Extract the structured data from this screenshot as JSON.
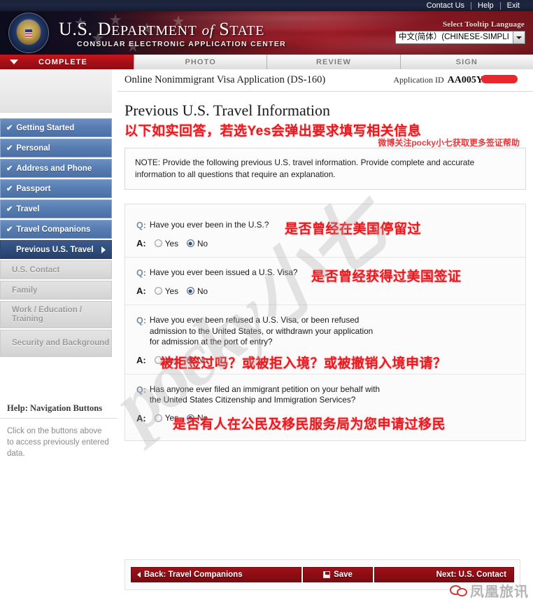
{
  "utility": {
    "links": [
      "Contact Us",
      "Help",
      "Exit"
    ]
  },
  "header": {
    "title_part1": "U.S. D",
    "title_epartment": "EPARTMENT",
    "title_of": "of",
    "title_s": "S",
    "title_tate": "TATE",
    "title_full": "U.S. DEPARTMENT of STATE",
    "subtitle": "CONSULAR ELECTRONIC APPLICATION CENTER",
    "language_label": "Select Tooltip Language",
    "language_value": "中文(简体）(CHINESE-SIMPLI"
  },
  "tabs": [
    {
      "label": "COMPLETE",
      "state": "active"
    },
    {
      "label": "PHOTO",
      "state": "inactive"
    },
    {
      "label": "REVIEW",
      "state": "inactive"
    },
    {
      "label": "SIGN",
      "state": "inactive"
    }
  ],
  "sidebar": {
    "items": [
      {
        "label": "Getting Started",
        "state": "completed"
      },
      {
        "label": "Personal",
        "state": "completed"
      },
      {
        "label": "Address and Phone",
        "state": "completed"
      },
      {
        "label": "Passport",
        "state": "completed"
      },
      {
        "label": "Travel",
        "state": "completed"
      },
      {
        "label": "Travel Companions",
        "state": "completed"
      },
      {
        "label": "Previous U.S. Travel",
        "state": "current"
      },
      {
        "label": "U.S. Contact",
        "state": "disabled"
      },
      {
        "label": "Family",
        "state": "disabled"
      },
      {
        "label": "Work / Education / Training",
        "state": "disabled"
      },
      {
        "label": "Security and Background",
        "state": "disabled"
      }
    ],
    "check_glyph": "✔",
    "help_title": "Help: Navigation Buttons",
    "help_text": "Click on the buttons above to access previously entered data."
  },
  "content": {
    "app_title": "Online Nonimmigrant Visa Application (DS-160)",
    "app_id_label": "Application ID",
    "app_id_value": "AA005Y",
    "page_title": "Previous U.S. Travel Information",
    "cn_instruction": "以下如实回答，若选Yes会弹出要求填写相关信息",
    "note_text": "NOTE: Provide the following previous U.S. travel information. Provide complete and accurate information to all questions that require an explanation.",
    "note_weibo": "微博关注pocky小七获取更多签证帮助"
  },
  "questions": [
    {
      "q_tag": "Q:",
      "a_tag": "A:",
      "text": "Have you ever been in the U.S.?",
      "cn_annotation": "是否曾经在美国停留过",
      "options": [
        {
          "label": "Yes",
          "checked": false
        },
        {
          "label": "No",
          "checked": true
        }
      ]
    },
    {
      "q_tag": "Q:",
      "a_tag": "A:",
      "text": "Have you ever been issued a U.S. Visa?",
      "cn_annotation": "是否曾经获得过美国签证",
      "options": [
        {
          "label": "Yes",
          "checked": false
        },
        {
          "label": "No",
          "checked": true
        }
      ]
    },
    {
      "q_tag": "Q:",
      "a_tag": "A:",
      "text": "Have you ever been refused a U.S. Visa, or been refused admission to the United States, or withdrawn your application for admission at the port of entry?",
      "cn_annotation": "被拒签过吗？或被拒入境？或被撤销入境申请？",
      "options": [
        {
          "label": "Yes",
          "checked": false
        },
        {
          "label": "No",
          "checked": true
        }
      ]
    },
    {
      "q_tag": "Q:",
      "a_tag": "A:",
      "text": "Has anyone ever filed an immigrant petition on your behalf with the United States Citizenship and Immigration Services?",
      "cn_annotation": "是否有人在公民及移民服务局为您申请过移民",
      "options": [
        {
          "label": "Yes",
          "checked": false
        },
        {
          "label": "No",
          "checked": true
        }
      ]
    }
  ],
  "footer": {
    "back_label": "Back: Travel Companions",
    "save_label": "Save",
    "next_label": "Next: U.S. Contact"
  },
  "watermarks": {
    "pocky": "pocky小七",
    "wechat": "凤凰旅讯"
  },
  "colors": {
    "accent_red": "#a80f17",
    "nav_blue": "#577eb4",
    "nav_current": "#2f4d7c",
    "annotation_red": "#e8191f"
  }
}
